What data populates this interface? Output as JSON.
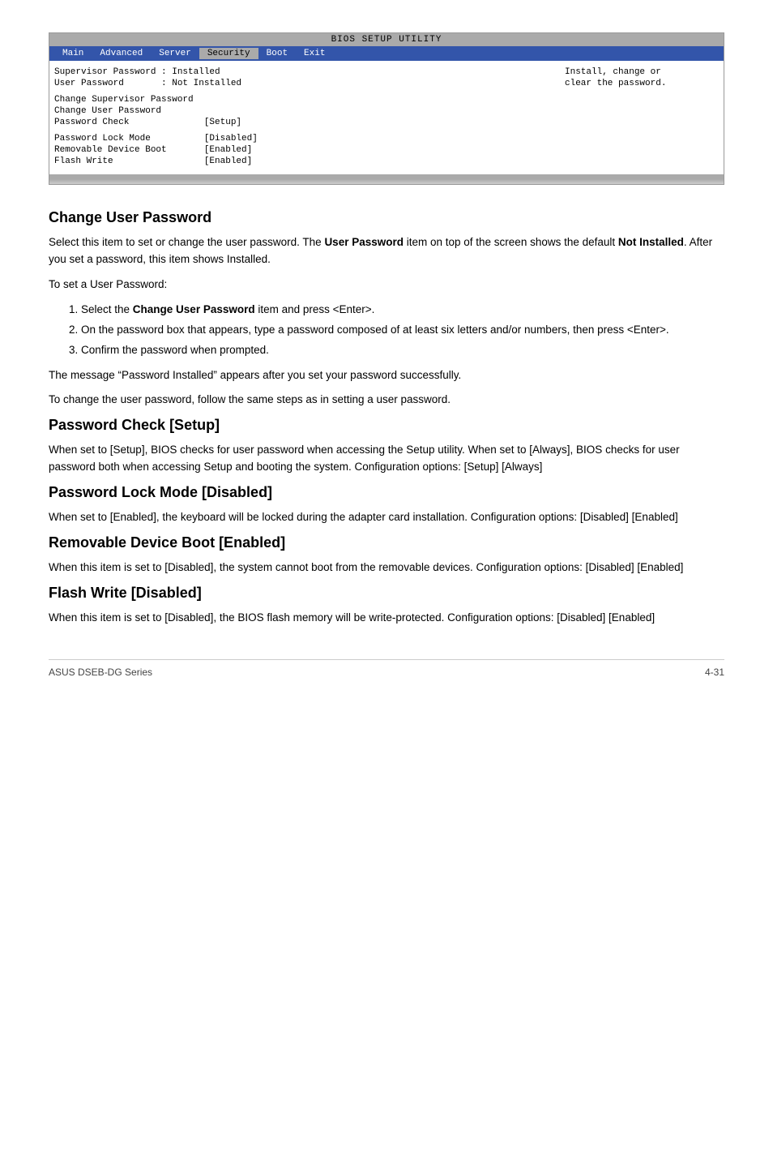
{
  "bios": {
    "title": "BIOS SETUP UTILITY",
    "nav_items": [
      "Main",
      "Advanced",
      "Server",
      "Security",
      "Boot",
      "Exit"
    ],
    "active_tab": "Security",
    "left_content": [
      {
        "text": "Supervisor Password : Installed",
        "indent": 0
      },
      {
        "text": "User Password       : Not Installed",
        "indent": 0
      },
      {
        "text": "",
        "indent": 0
      },
      {
        "text": "Change Supervisor Password",
        "indent": 0
      },
      {
        "text": "Change User Password",
        "indent": 0
      },
      {
        "text": "Password Check              [Setup]",
        "indent": 0
      },
      {
        "text": "",
        "indent": 0
      },
      {
        "text": "Password Lock Mode          [Disabled]",
        "indent": 0
      },
      {
        "text": "Removable Device Boot       [Enabled]",
        "indent": 0
      },
      {
        "text": "Flash Write                 [Enabled]",
        "indent": 0
      }
    ],
    "right_content": [
      "Install, change or",
      "clear the password."
    ]
  },
  "sections": [
    {
      "id": "change-user-password",
      "heading": "Change User Password",
      "paragraphs": [
        "Select this item to set or change the user password. The <b>User Password</b> item on top of the screen shows the default <b>Not Installed</b>. After you set a password, this item shows Installed.",
        "To set a User Password:"
      ],
      "list_items": [
        "Select the <b>Change User Password</b> item and press &lt;Enter&gt;.",
        "On the password box that appears, type a password composed of at least six letters and/or numbers, then press &lt;Enter&gt;.",
        "Confirm the password when prompted."
      ],
      "after_list": [
        "The message “Password Installed” appears after you set your password successfully.",
        "To change the user password, follow the same steps as in setting a user password."
      ]
    },
    {
      "id": "password-check",
      "heading": "Password Check [Setup]",
      "paragraphs": [
        "When set to [Setup], BIOS checks for user password when accessing the Setup utility. When set to [Always], BIOS checks for user password both when accessing Setup and booting the system. Configuration options: [Setup] [Always]"
      ],
      "list_items": [],
      "after_list": []
    },
    {
      "id": "password-lock-mode",
      "heading": "Password Lock Mode [Disabled]",
      "paragraphs": [
        "When set to [Enabled], the keyboard will be locked during the adapter card installation. Configuration options: [Disabled] [Enabled]"
      ],
      "list_items": [],
      "after_list": []
    },
    {
      "id": "removable-device-boot",
      "heading": "Removable Device Boot [Enabled]",
      "paragraphs": [
        "When this item is set to [Disabled], the system cannot boot from the removable devices. Configuration options: [Disabled] [Enabled]"
      ],
      "list_items": [],
      "after_list": []
    },
    {
      "id": "flash-write",
      "heading": "Flash Write [Disabled]",
      "paragraphs": [
        "When this item is set to [Disabled], the BIOS flash memory will be write-protected. Configuration options: [Disabled] [Enabled]"
      ],
      "list_items": [],
      "after_list": []
    }
  ],
  "footer": {
    "left": "ASUS DSEB-DG Series",
    "right": "4-31"
  }
}
